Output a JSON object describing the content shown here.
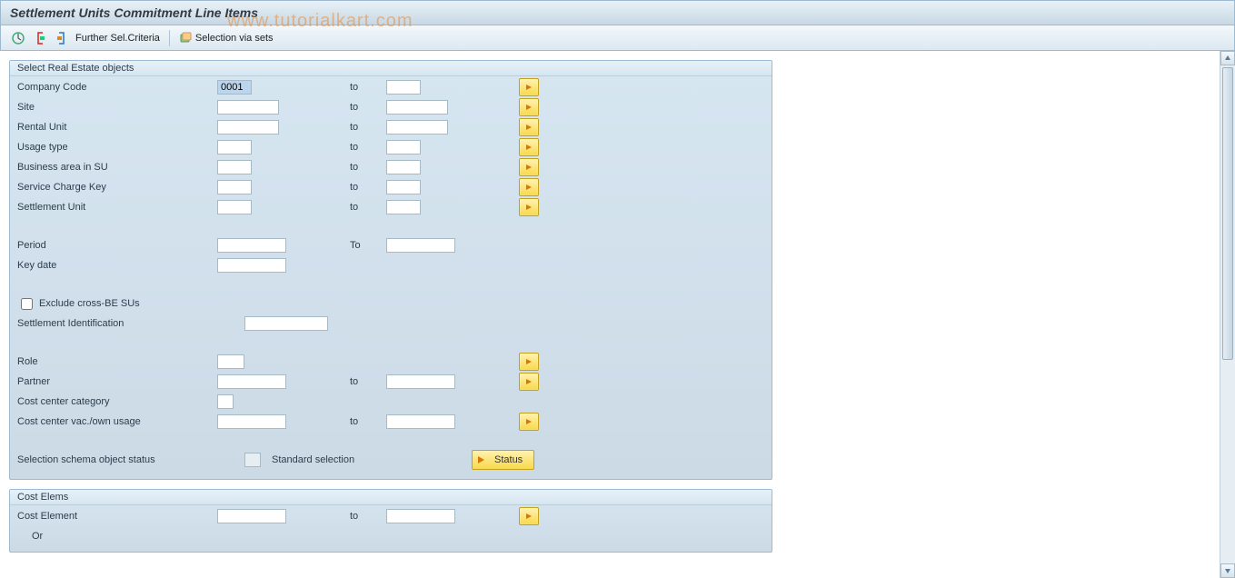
{
  "header": {
    "title": "Settlement Units Commitment Line Items"
  },
  "toolbar": {
    "further_sel_criteria": "Further Sel.Criteria",
    "selection_via_sets": "Selection via sets"
  },
  "group1": {
    "title": "Select Real Estate objects",
    "company_code_lbl": "Company Code",
    "company_code_from": "0001",
    "company_code_to": "",
    "site_lbl": "Site",
    "site_from": "",
    "site_to": "",
    "rental_unit_lbl": "Rental Unit",
    "rental_unit_from": "",
    "rental_unit_to": "",
    "usage_type_lbl": "Usage type",
    "usage_type_from": "",
    "usage_type_to": "",
    "business_area_lbl": "Business area in SU",
    "business_area_from": "",
    "business_area_to": "",
    "service_charge_lbl": "Service Charge Key",
    "service_charge_from": "",
    "service_charge_to": "",
    "settlement_unit_lbl": "Settlement Unit",
    "settlement_unit_from": "",
    "settlement_unit_to": "",
    "to_lbl": "to",
    "period_lbl": "Period",
    "period_from": "",
    "period_to_lbl": "To",
    "period_to": "",
    "key_date_lbl": "Key date",
    "key_date": "",
    "exclude_lbl": "Exclude cross-BE SUs",
    "exclude_checked": false,
    "settlement_id_lbl": "Settlement Identification",
    "settlement_id": "",
    "role_lbl": "Role",
    "role_from": "",
    "partner_lbl": "Partner",
    "partner_from": "",
    "partner_to": "",
    "cc_category_lbl": "Cost center category",
    "cc_category": "",
    "cc_vac_lbl": "Cost center vac./own usage",
    "cc_vac_from": "",
    "cc_vac_to": "",
    "sel_schema_lbl": "Selection schema object status",
    "sel_schema_val": "",
    "standard_selection_lbl": "Standard selection",
    "status_btn": "Status"
  },
  "group2": {
    "title": "Cost Elems",
    "cost_element_lbl": "Cost Element",
    "cost_element_from": "",
    "cost_element_to": "",
    "to_lbl": "to",
    "or_lbl": "Or"
  },
  "watermark": "www.tutorialkart.com"
}
